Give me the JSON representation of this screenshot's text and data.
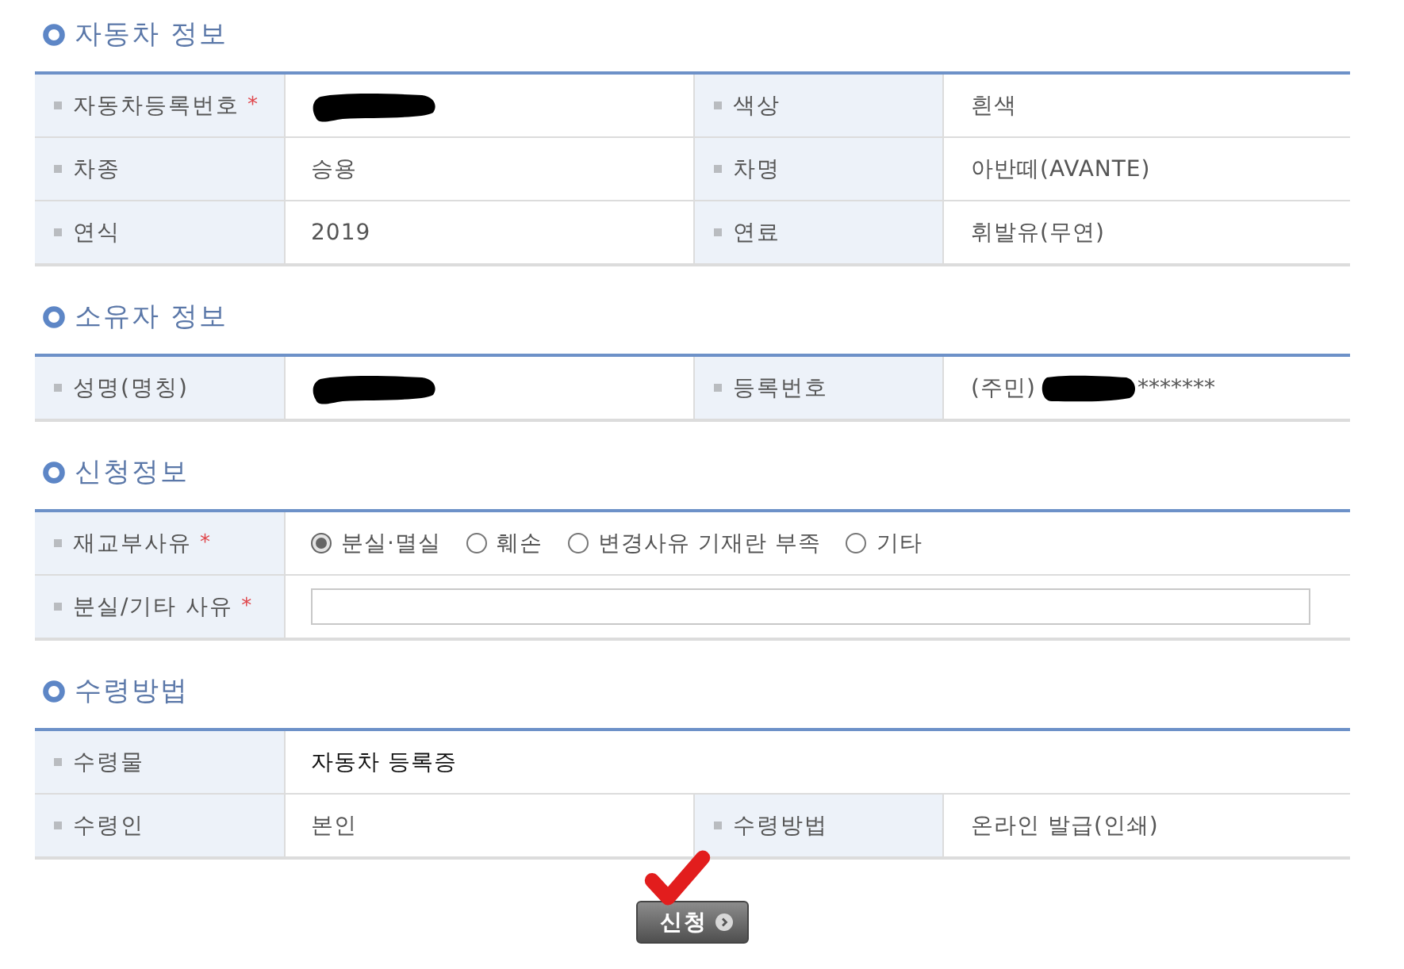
{
  "sections": [
    {
      "title": "자동차 정보",
      "rows": [
        {
          "fields": [
            {
              "label": "자동차등록번호",
              "required_mark": "*",
              "kind": "redacted"
            },
            {
              "label": "색상",
              "kind": "text",
              "value": "흰색",
              "strong": false
            }
          ]
        },
        {
          "fields": [
            {
              "label": "차종",
              "kind": "text",
              "value": "승용",
              "strong": false
            },
            {
              "label": "차명",
              "kind": "text",
              "value": "아반떼(AVANTE)",
              "strong": false
            }
          ]
        },
        {
          "fields": [
            {
              "label": "연식",
              "kind": "text",
              "value": "2019",
              "strong": false
            },
            {
              "label": "연료",
              "kind": "text",
              "value": "휘발유(무연)",
              "strong": false
            }
          ]
        }
      ]
    },
    {
      "title": "소유자 정보",
      "rows": [
        {
          "fields": [
            {
              "label": "성명(명칭)",
              "kind": "redacted"
            },
            {
              "label": "등록번호",
              "kind": "masked",
              "prefix": "(주민)",
              "suffix": "*******"
            }
          ]
        }
      ]
    },
    {
      "title": "신청정보",
      "rows": [
        {
          "fields": [
            {
              "label": "재교부사유",
              "required_mark": "*",
              "kind": "radio",
              "options": [
                {
                  "label": "분실·멸실",
                  "selected": true
                },
                {
                  "label": "훼손",
                  "selected": false
                },
                {
                  "label": "변경사유 기재란 부족",
                  "selected": false
                },
                {
                  "label": "기타",
                  "selected": false
                }
              ]
            }
          ]
        },
        {
          "fields": [
            {
              "label": "분실/기타 사유",
              "required_mark": "*",
              "kind": "input"
            }
          ]
        }
      ]
    },
    {
      "title": "수령방법",
      "rows": [
        {
          "fields": [
            {
              "label": "수령물",
              "kind": "text",
              "value": "자동차 등록증",
              "strong": true
            }
          ]
        },
        {
          "fields": [
            {
              "label": "수령인",
              "kind": "text",
              "value": "본인",
              "strong": false
            },
            {
              "label": "수령방법",
              "kind": "text",
              "value": "온라인 발급(인쇄)",
              "strong": false
            }
          ]
        }
      ]
    }
  ],
  "submit_button": {
    "label": "신청"
  }
}
